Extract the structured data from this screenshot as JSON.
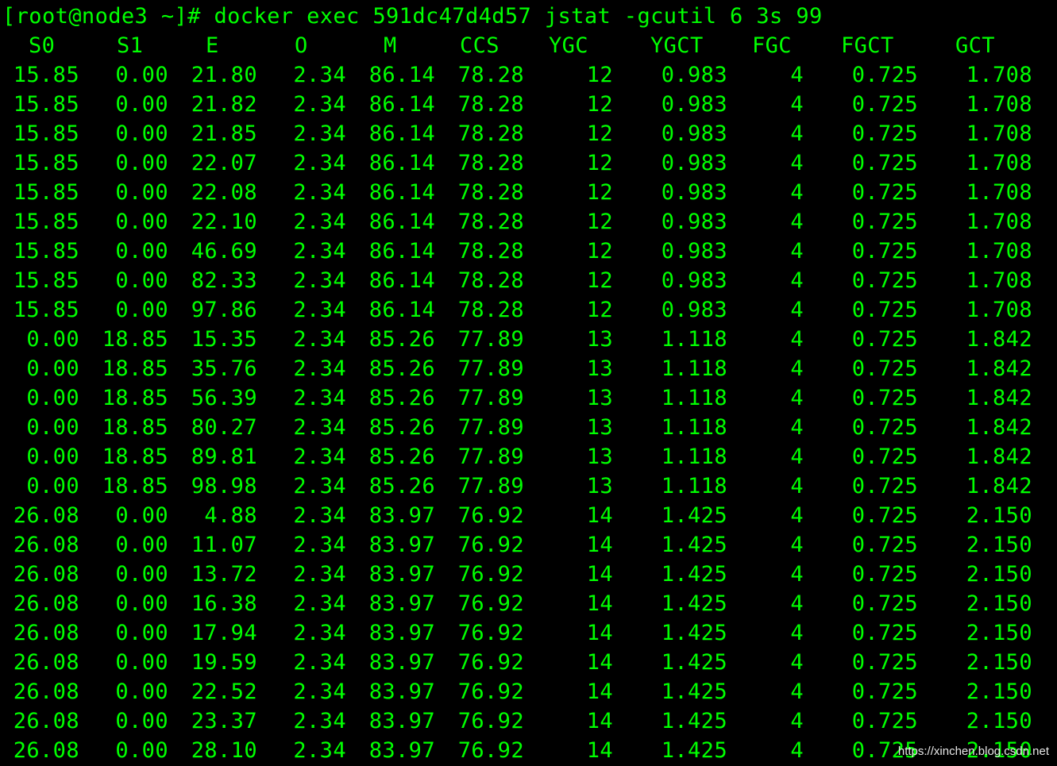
{
  "terminal": {
    "background": "#000000",
    "text_color": "#00ff00",
    "prompt": "[root@node3 ~]# docker exec 591dc47d4d57 jstat -gcutil 6 3s 99",
    "columns": [
      "S0",
      "S1",
      "E",
      "O",
      "M",
      "CCS",
      "YGC",
      "YGCT",
      "FGC",
      "FGCT",
      "GCT"
    ],
    "rows": [
      [
        "15.85",
        "0.00",
        "21.80",
        "2.34",
        "86.14",
        "78.28",
        "12",
        "0.983",
        "4",
        "0.725",
        "1.708"
      ],
      [
        "15.85",
        "0.00",
        "21.82",
        "2.34",
        "86.14",
        "78.28",
        "12",
        "0.983",
        "4",
        "0.725",
        "1.708"
      ],
      [
        "15.85",
        "0.00",
        "21.85",
        "2.34",
        "86.14",
        "78.28",
        "12",
        "0.983",
        "4",
        "0.725",
        "1.708"
      ],
      [
        "15.85",
        "0.00",
        "22.07",
        "2.34",
        "86.14",
        "78.28",
        "12",
        "0.983",
        "4",
        "0.725",
        "1.708"
      ],
      [
        "15.85",
        "0.00",
        "22.08",
        "2.34",
        "86.14",
        "78.28",
        "12",
        "0.983",
        "4",
        "0.725",
        "1.708"
      ],
      [
        "15.85",
        "0.00",
        "22.10",
        "2.34",
        "86.14",
        "78.28",
        "12",
        "0.983",
        "4",
        "0.725",
        "1.708"
      ],
      [
        "15.85",
        "0.00",
        "46.69",
        "2.34",
        "86.14",
        "78.28",
        "12",
        "0.983",
        "4",
        "0.725",
        "1.708"
      ],
      [
        "15.85",
        "0.00",
        "82.33",
        "2.34",
        "86.14",
        "78.28",
        "12",
        "0.983",
        "4",
        "0.725",
        "1.708"
      ],
      [
        "15.85",
        "0.00",
        "97.86",
        "2.34",
        "86.14",
        "78.28",
        "12",
        "0.983",
        "4",
        "0.725",
        "1.708"
      ],
      [
        "0.00",
        "18.85",
        "15.35",
        "2.34",
        "85.26",
        "77.89",
        "13",
        "1.118",
        "4",
        "0.725",
        "1.842"
      ],
      [
        "0.00",
        "18.85",
        "35.76",
        "2.34",
        "85.26",
        "77.89",
        "13",
        "1.118",
        "4",
        "0.725",
        "1.842"
      ],
      [
        "0.00",
        "18.85",
        "56.39",
        "2.34",
        "85.26",
        "77.89",
        "13",
        "1.118",
        "4",
        "0.725",
        "1.842"
      ],
      [
        "0.00",
        "18.85",
        "80.27",
        "2.34",
        "85.26",
        "77.89",
        "13",
        "1.118",
        "4",
        "0.725",
        "1.842"
      ],
      [
        "0.00",
        "18.85",
        "89.81",
        "2.34",
        "85.26",
        "77.89",
        "13",
        "1.118",
        "4",
        "0.725",
        "1.842"
      ],
      [
        "0.00",
        "18.85",
        "98.98",
        "2.34",
        "85.26",
        "77.89",
        "13",
        "1.118",
        "4",
        "0.725",
        "1.842"
      ],
      [
        "26.08",
        "0.00",
        "4.88",
        "2.34",
        "83.97",
        "76.92",
        "14",
        "1.425",
        "4",
        "0.725",
        "2.150"
      ],
      [
        "26.08",
        "0.00",
        "11.07",
        "2.34",
        "83.97",
        "76.92",
        "14",
        "1.425",
        "4",
        "0.725",
        "2.150"
      ],
      [
        "26.08",
        "0.00",
        "13.72",
        "2.34",
        "83.97",
        "76.92",
        "14",
        "1.425",
        "4",
        "0.725",
        "2.150"
      ],
      [
        "26.08",
        "0.00",
        "16.38",
        "2.34",
        "83.97",
        "76.92",
        "14",
        "1.425",
        "4",
        "0.725",
        "2.150"
      ],
      [
        "26.08",
        "0.00",
        "17.94",
        "2.34",
        "83.97",
        "76.92",
        "14",
        "1.425",
        "4",
        "0.725",
        "2.150"
      ],
      [
        "26.08",
        "0.00",
        "19.59",
        "2.34",
        "83.97",
        "76.92",
        "14",
        "1.425",
        "4",
        "0.725",
        "2.150"
      ],
      [
        "26.08",
        "0.00",
        "22.52",
        "2.34",
        "83.97",
        "76.92",
        "14",
        "1.425",
        "4",
        "0.725",
        "2.150"
      ],
      [
        "26.08",
        "0.00",
        "23.37",
        "2.34",
        "83.97",
        "76.92",
        "14",
        "1.425",
        "4",
        "0.725",
        "2.150"
      ],
      [
        "26.08",
        "0.00",
        "28.10",
        "2.34",
        "83.97",
        "76.92",
        "14",
        "1.425",
        "4",
        "0.725",
        "2.150"
      ]
    ]
  },
  "watermark": "https://xinchen.blog.csdn.net"
}
